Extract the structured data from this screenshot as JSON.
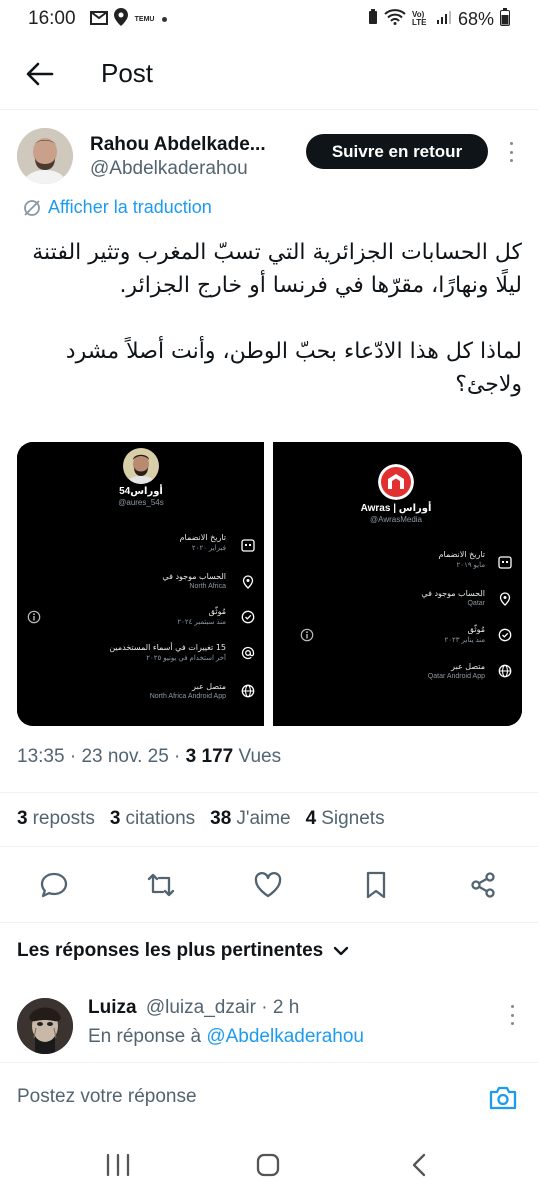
{
  "status_bar": {
    "time": "16:00",
    "temu": "TEMU",
    "signal_label": "Vo) LTE",
    "battery": "68%"
  },
  "header": {
    "title": "Post",
    "back_icon": "arrow-left-icon"
  },
  "post": {
    "author_name": "Rahou Abdelkade...",
    "author_handle": "@Abdelkaderahou",
    "follow_label": "Suivre en retour",
    "translate_label": "Afficher la traduction",
    "text_p1": "كل الحسابات الجزائرية التي تسبّ المغرب وتثير الفتنة ليلًا ونهارًا، مقرّها في فرنسا أو خارج الجزائر.",
    "text_p2": "لماذا كل هذا الادّعاء بحبّ الوطن، وأنت أصلاً مشرد ولاجئ؟",
    "time": "13:35",
    "date": "23 nov. 25",
    "views_count": "3 177",
    "views_label": "Vues",
    "reposts_count": "3",
    "reposts_label": "reposts",
    "citations_count": "3",
    "citations_label": "citations",
    "likes_count": "38",
    "likes_label": "J'aime",
    "bookmarks_count": "4",
    "bookmarks_label": "Signets"
  },
  "media": {
    "left": {
      "name": "أوراس54",
      "handle": "@aures_54s",
      "rows": [
        {
          "label": "تاريخ الانضمام",
          "sub": "فبراير ٢٠٢٠"
        },
        {
          "label": "الحساب موجود في",
          "sub": "North Africa"
        },
        {
          "label": "مُوثّق",
          "sub": "منذ سبتمبر ٢٠٢٤"
        },
        {
          "label": "15 تغييرات في أسماء المستخدمين",
          "sub": "آخر استخدام في يونيو ٢٠٢٥"
        },
        {
          "label": "متصل عبر",
          "sub": "North Africa Android App"
        }
      ]
    },
    "right": {
      "name": "Awras | أوراس",
      "handle": "@AwrasMedia",
      "rows": [
        {
          "label": "تاريخ الانضمام",
          "sub": "مايو ٢٠١٩"
        },
        {
          "label": "الحساب موجود في",
          "sub": "Qatar"
        },
        {
          "label": "مُوثّق",
          "sub": "منذ يناير ٢٠٢٣"
        },
        {
          "label": "متصل عبر",
          "sub": "Qatar Android App"
        }
      ]
    }
  },
  "replies": {
    "filter_label": "Les réponses les plus pertinentes",
    "items": [
      {
        "name": "Luiza",
        "handle": "@luiza_dzair",
        "age": "· 2 h",
        "reply_prefix": "En réponse à",
        "reply_to": "@Abdelkaderahou"
      }
    ]
  },
  "compose": {
    "placeholder": "Postez votre réponse"
  },
  "colors": {
    "accent": "#1d9bf0",
    "text": "#0f1419",
    "muted": "#536471"
  }
}
